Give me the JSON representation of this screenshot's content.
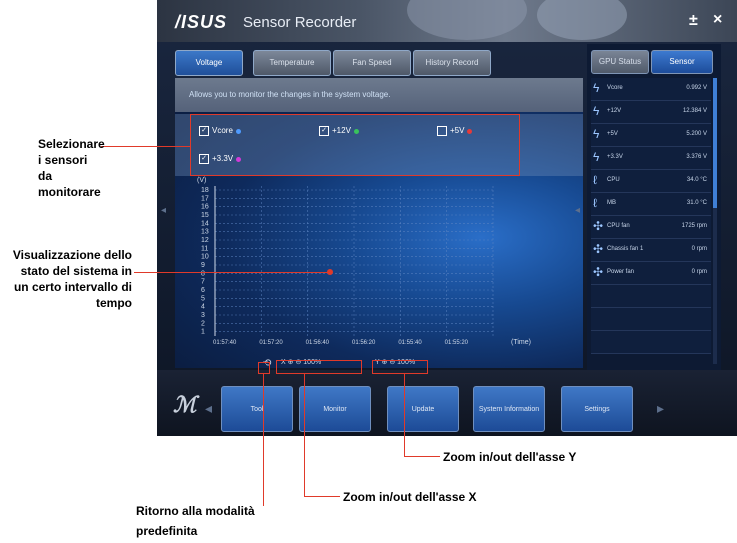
{
  "window": {
    "logo": "/ISUS",
    "title": "Sensor Recorder",
    "minimize": "±",
    "close": "×"
  },
  "tabs": [
    {
      "label": "Voltage",
      "active": true
    },
    {
      "label": "Temperature",
      "active": false
    },
    {
      "label": "Fan Speed",
      "active": false
    },
    {
      "label": "History Record",
      "active": false
    }
  ],
  "description": "Allows you to monitor the changes in the system voltage.",
  "sensors": [
    {
      "label": "Vcore",
      "checked": true,
      "color": "#4f9bff"
    },
    {
      "label": "+12V",
      "checked": true,
      "color": "#39c35c"
    },
    {
      "label": "+5V",
      "checked": false,
      "color": "#e53a3a"
    },
    {
      "label": "+3.3V",
      "checked": true,
      "color": "#d23ad8"
    }
  ],
  "chart": {
    "y_unit": "(V)",
    "y_ticks": [
      "18",
      "17",
      "16",
      "15",
      "14",
      "13",
      "12",
      "11",
      "10",
      "9",
      "8",
      "7",
      "6",
      "5",
      "4",
      "3",
      "2",
      "1"
    ],
    "x_unit": "(Time)",
    "x_ticks": [
      "01:57:40",
      "01:57:20",
      "01:56:40",
      "01:56:20",
      "01:55:40",
      "01:55:20"
    ]
  },
  "zoom": {
    "x_label": "X",
    "x_value": "100%",
    "y_label": "Y",
    "y_value": "100%"
  },
  "right_tabs": [
    {
      "label": "GPU Status",
      "active": false
    },
    {
      "label": "Sensor",
      "active": true
    }
  ],
  "right_sensors": [
    {
      "icon": "bolt",
      "name": "Vcore",
      "value": "0.992 V"
    },
    {
      "icon": "bolt",
      "name": "+12V",
      "value": "12.384 V"
    },
    {
      "icon": "bolt",
      "name": "+5V",
      "value": "5.200 V"
    },
    {
      "icon": "bolt",
      "name": "+3.3V",
      "value": "3.376 V"
    },
    {
      "icon": "thermometer",
      "name": "CPU",
      "value": "34.0 °C"
    },
    {
      "icon": "thermometer",
      "name": "MB",
      "value": "31.0 °C"
    },
    {
      "icon": "fan",
      "name": "CPU fan",
      "value": "1725 rpm"
    },
    {
      "icon": "fan",
      "name": "Chassis fan 1",
      "value": "0 rpm"
    },
    {
      "icon": "fan",
      "name": "Power fan",
      "value": "0 rpm"
    }
  ],
  "nav": [
    {
      "label": "Tool"
    },
    {
      "label": "Monitor"
    },
    {
      "label": "Update"
    },
    {
      "label": "System Information"
    },
    {
      "label": "Settings"
    }
  ],
  "annotations": {
    "select_sensors": "Selezionare i sensori da monitorare",
    "visualization": "Visualizzazione dello stato del sistema in un certo intervallo di tempo",
    "zoom_y": "Zoom in/out dell'asse Y",
    "zoom_x": "Zoom in/out dell'asse X",
    "reset": "Ritorno alla modalità predefinita"
  }
}
